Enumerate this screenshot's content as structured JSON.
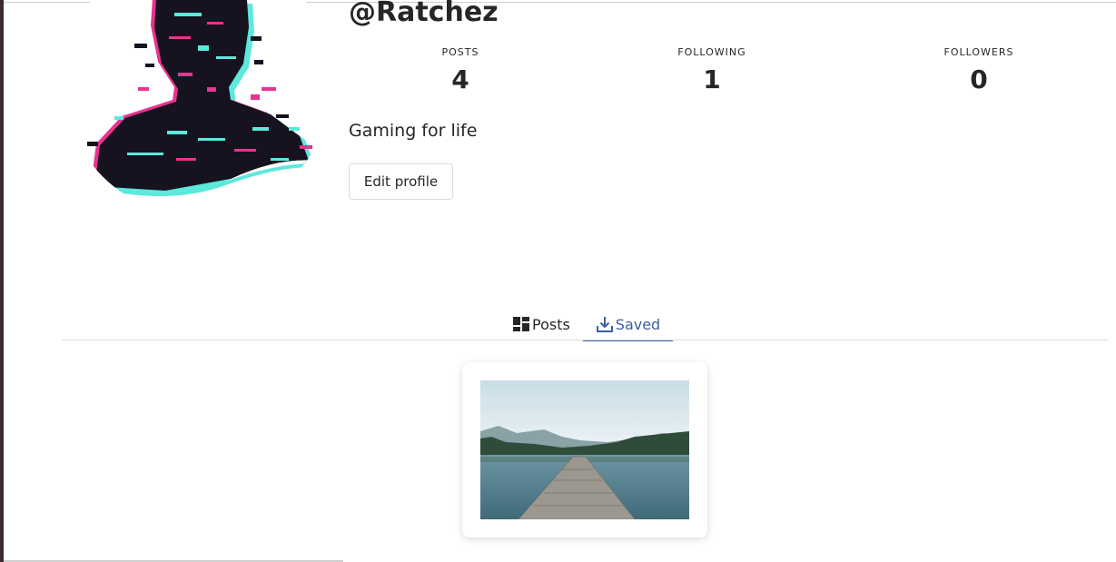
{
  "profile": {
    "username": "@Ratchez",
    "bio": "Gaming for life",
    "edit_button_label": "Edit profile"
  },
  "stats": {
    "posts_label": "POSTS",
    "posts_value": "4",
    "following_label": "FOLLOWING",
    "following_value": "1",
    "followers_label": "FOLLOWERS",
    "followers_value": "0"
  },
  "tabs": [
    {
      "label": "Posts",
      "icon": "grid-icon",
      "active": false
    },
    {
      "label": "Saved",
      "icon": "download-icon",
      "active": true
    }
  ],
  "colors": {
    "active_tab": "#3b5fa6",
    "avatar_dark": "#16121f",
    "avatar_pink": "#e8338f",
    "avatar_cyan": "#5de8dc"
  },
  "saved_posts": [
    {
      "image": "lake-dock-photo"
    }
  ]
}
